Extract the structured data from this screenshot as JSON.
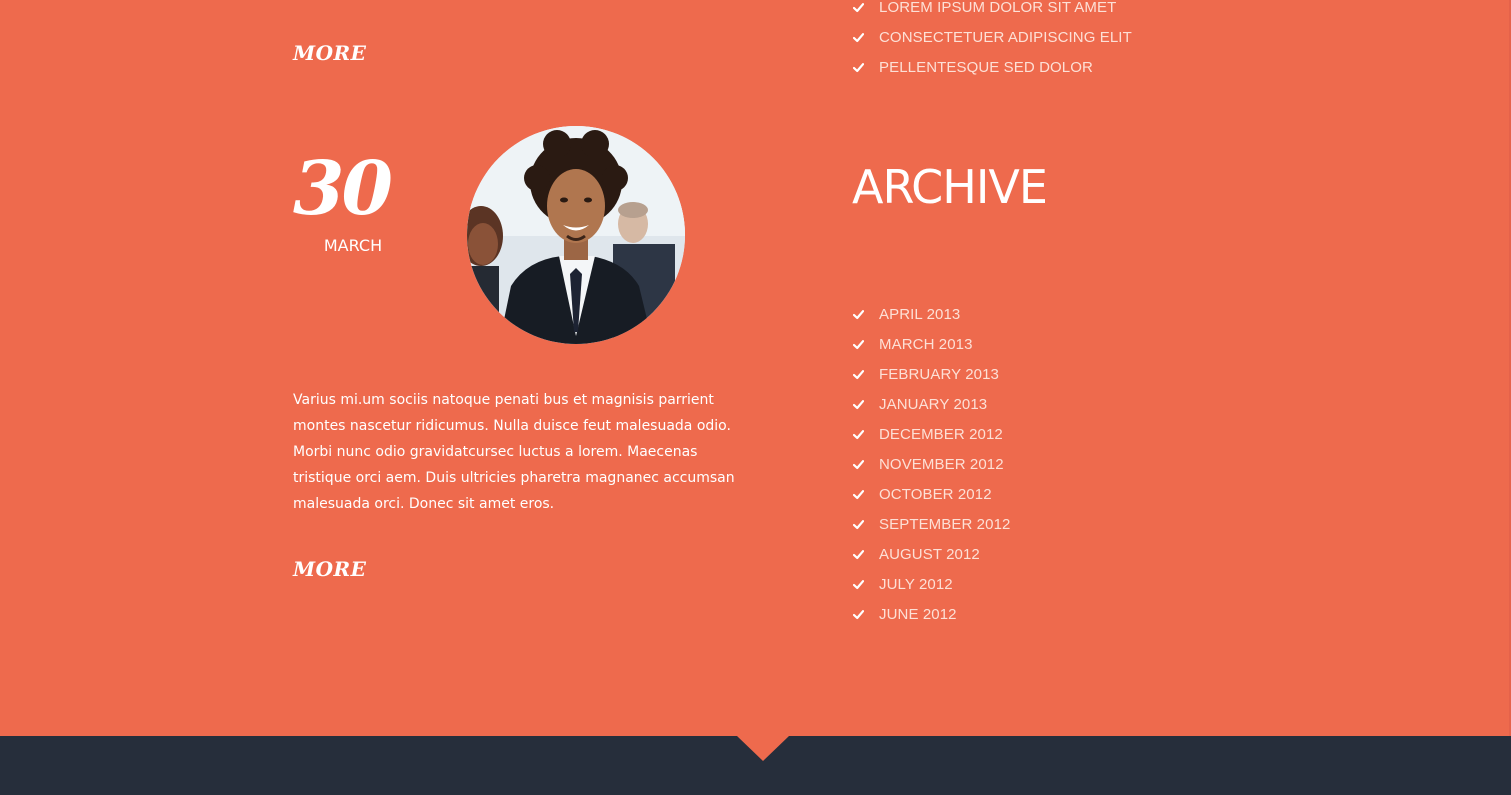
{
  "post": {
    "more_top_label": "MORE",
    "date_day": "30",
    "date_month": "MARCH",
    "text": "Varius mi.um sociis natoque penati bus et magnisis parrient montes nascetur ridicumus. Nulla duisce feut malesuada odio. Morbi nunc odio gravidatcursec luctus a lorem. Maecenas tristique orci aem. Duis ultricies pharetra magnanec accumsan malesuada orci. Donec sit amet eros.",
    "more_bottom_label": "MORE"
  },
  "sidebar": {
    "top_list": [
      {
        "label": "LOREM IPSUM DOLOR SIT AMET"
      },
      {
        "label": "CONSECTETUER ADIPISCING ELIT"
      },
      {
        "label": "PELLENTESQUE SED DOLOR"
      }
    ],
    "archive_title": "ARCHIVE",
    "archive_items": [
      {
        "label": "APRIL 2013"
      },
      {
        "label": "MARCH 2013"
      },
      {
        "label": "FEBRUARY 2013"
      },
      {
        "label": "JANUARY 2013"
      },
      {
        "label": "DECEMBER 2012"
      },
      {
        "label": "NOVEMBER 2012"
      },
      {
        "label": "OCTOBER 2012"
      },
      {
        "label": "SEPTEMBER 2012"
      },
      {
        "label": "AUGUST 2012"
      },
      {
        "label": "JULY 2012"
      },
      {
        "label": "JUNE 2012"
      }
    ]
  },
  "icons": {
    "list_bullet": "check-icon",
    "avatar": "avatar"
  },
  "colors": {
    "background": "#ee6a4d",
    "footer": "#262e3b",
    "text": "#ffffff",
    "list_text": "#fde0d6"
  }
}
